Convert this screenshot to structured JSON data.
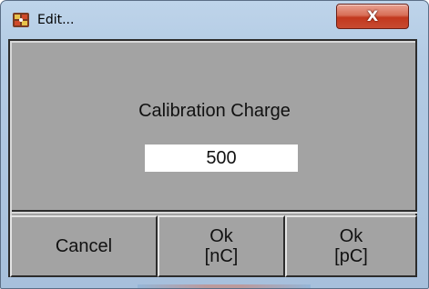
{
  "window": {
    "title": "Edit...",
    "app_icon": "calibration-app-icon",
    "close_icon": "close-icon",
    "close_glyph": "X"
  },
  "dialog": {
    "heading": "Calibration Charge",
    "value": "500"
  },
  "buttons": {
    "cancel": "Cancel",
    "ok_nc": "Ok\n[nC]",
    "ok_pc": "Ok\n[pC]"
  },
  "colors": {
    "dialog_background": "#a3a3a3",
    "close_button": "#c74a30",
    "title_bar": "#b3cbe4"
  }
}
